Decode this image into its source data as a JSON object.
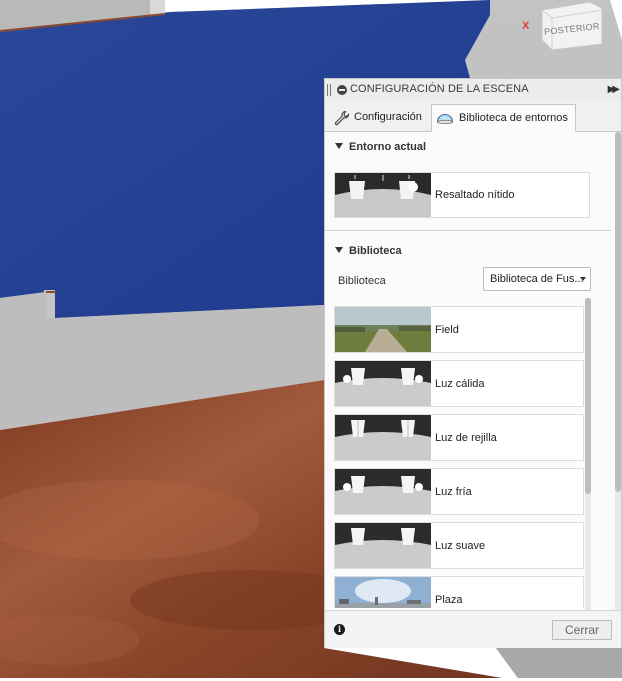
{
  "viewport": {
    "axis_label": "X",
    "viewcube_label": "POSTERIOR",
    "colors": {
      "blue_surface": "#233f94",
      "grey_wall": "#b8b8b8",
      "wood_floor": "#8c4a30"
    }
  },
  "panel": {
    "title": "CONFIGURACIÓN DE LA ESCENA",
    "tabs": [
      {
        "label": "Configuración",
        "icon": "wrench-icon",
        "active": false
      },
      {
        "label": "Biblioteca de entornos",
        "icon": "dome-icon",
        "active": true
      }
    ],
    "current_environment": {
      "heading": "Entorno actual",
      "item": {
        "name": "Resaltado nítido",
        "thumb": "studio"
      }
    },
    "library": {
      "heading": "Biblioteca",
      "select_label": "Biblioteca",
      "select_value": "Biblioteca de Fus...",
      "items": [
        {
          "name": "Field",
          "thumb": "field"
        },
        {
          "name": "Luz cálida",
          "thumb": "studio"
        },
        {
          "name": "Luz de rejilla",
          "thumb": "studio"
        },
        {
          "name": "Luz fría",
          "thumb": "studio"
        },
        {
          "name": "Luz suave",
          "thumb": "studio"
        },
        {
          "name": "Plaza",
          "thumb": "plaza"
        }
      ]
    },
    "footer": {
      "close_label": "Cerrar"
    }
  }
}
